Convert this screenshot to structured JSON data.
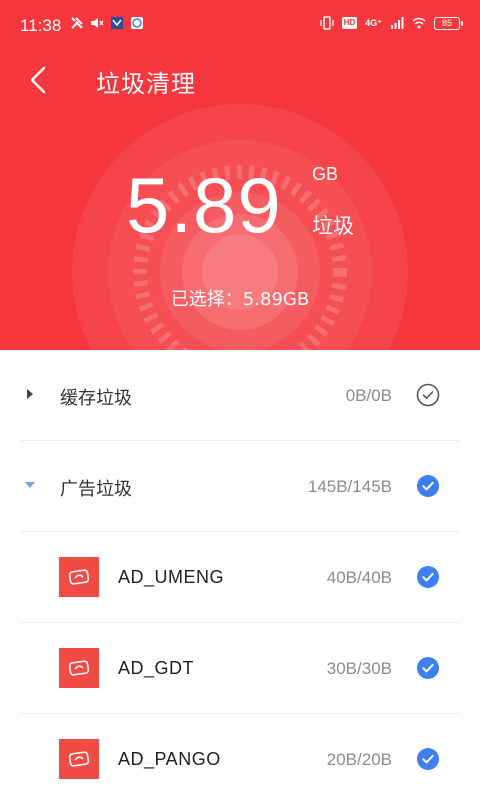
{
  "status_bar": {
    "time": "11:38",
    "network": "4G⁺",
    "hd": "HD",
    "battery": "85"
  },
  "header": {
    "title": "垃圾清理",
    "size_number": "5.89",
    "size_unit": "GB",
    "size_label": "垃圾",
    "selected_text": "已选择：5.89GB",
    "bg_color": "#f5373d"
  },
  "categories": [
    {
      "label": "缓存垃圾",
      "size": "0B/0B",
      "expanded": false,
      "checked": false
    },
    {
      "label": "广告垃圾",
      "size": "145B/145B",
      "expanded": true,
      "checked": true
    }
  ],
  "ad_items": [
    {
      "label": "AD_UMENG",
      "size": "40B/40B",
      "checked": true
    },
    {
      "label": "AD_GDT",
      "size": "30B/30B",
      "checked": true
    },
    {
      "label": "AD_PANGO",
      "size": "20B/20B",
      "checked": true
    }
  ],
  "colors": {
    "accent_blue": "#3d7ef0",
    "icon_red": "#f24a45"
  }
}
